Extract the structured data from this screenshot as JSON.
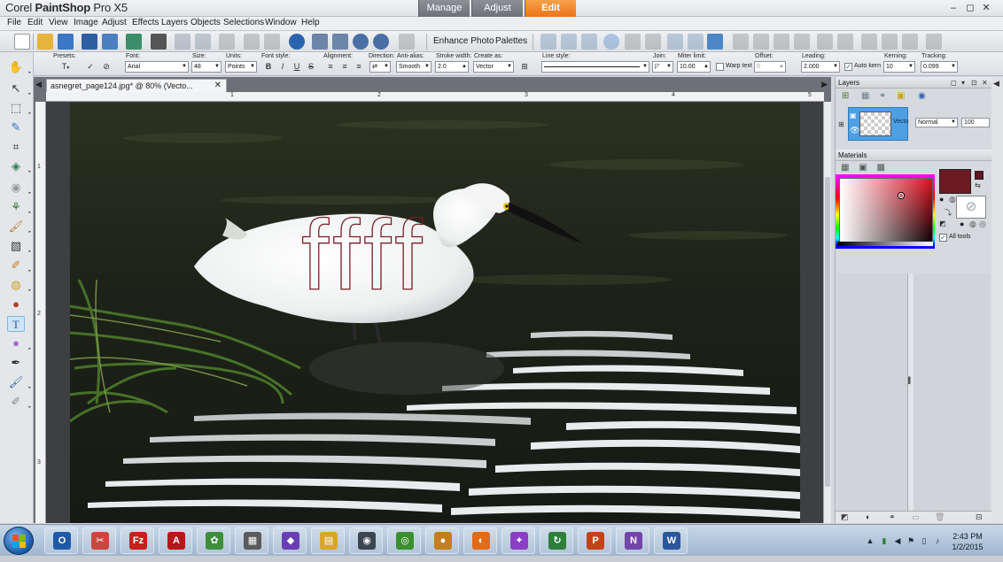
{
  "window": {
    "title_light": "Corel ",
    "title_bold": "PaintShop",
    "title_tail": " Pro X5",
    "workspace_tabs": [
      "Manage",
      "Adjust",
      "Edit"
    ],
    "active_tab": "Edit",
    "controls": {
      "minimize": "–",
      "restore": "◻",
      "close": "✕"
    }
  },
  "menu": [
    "File",
    "Edit",
    "View",
    "Image",
    "Adjust",
    "Effects",
    "Layers",
    "Objects",
    "Selections",
    "Window",
    "Help"
  ],
  "toolbar": {
    "enhance_photo": "Enhance Photo",
    "palettes": "Palettes"
  },
  "tool_options": {
    "presets_label": "Presets:",
    "font_label": "Font:",
    "font_value": "Arial",
    "size_label": "Size:",
    "size_value": "48",
    "units_label": "Units:",
    "units_value": "Points",
    "font_style_label": "Font style:",
    "style_buttons": [
      "B",
      "I",
      "U",
      "S"
    ],
    "alignment_label": "Alignment:",
    "direction_label": "Direction:",
    "antialias_label": "Anti-alias:",
    "antialias_value": "Smooth",
    "stroke_width_label": "Stroke width:",
    "stroke_width_value": "2.0",
    "create_as_label": "Create as:",
    "create_as_value": "Vector",
    "line_style_label": "Line style:",
    "join_label": "Join:",
    "miter_label": "Miter limit:",
    "miter_value": "10.00",
    "warp_text_label": "Warp text",
    "offset_label": "Offset:",
    "offset_value": "0",
    "leading_label": "Leading:",
    "leading_value": "2.000",
    "auto_kern_label": "Auto kern",
    "kerning_label": "Kerning:",
    "kerning_value": "10",
    "tracking_label": "Tracking:",
    "tracking_value": "0.099"
  },
  "document": {
    "tab_title": "asnegret_page124.jpg* @  80% (Vecto...",
    "overlay_text": "ffff",
    "ruler_h": [
      "1",
      "2",
      "3",
      "4",
      "5"
    ],
    "ruler_v": [
      "1",
      "2",
      "3"
    ]
  },
  "layers": {
    "title": "Layers",
    "layer_name": "Vecto",
    "blend_mode": "Normal",
    "opacity": "100"
  },
  "materials": {
    "title": "Materials",
    "all_tools_label": "All tools",
    "foreground_color": "#6b1a22",
    "background_color": "#5e1620"
  },
  "taskbar": {
    "apps": [
      {
        "name": "outlook",
        "glyph": "O",
        "color": "#1f5aa8"
      },
      {
        "name": "snipping-tool",
        "glyph": "✂",
        "color": "#c9473f"
      },
      {
        "name": "filezilla",
        "glyph": "Fz",
        "color": "#c8201b"
      },
      {
        "name": "acrobat",
        "glyph": "A",
        "color": "#b5181b"
      },
      {
        "name": "corel-paintshop",
        "glyph": "✿",
        "color": "#3f8f3a"
      },
      {
        "name": "photo-viewer",
        "glyph": "▦",
        "color": "#5a5a5a"
      },
      {
        "name": "paint-app",
        "glyph": "◆",
        "color": "#6a3fb5"
      },
      {
        "name": "explorer",
        "glyph": "▤",
        "color": "#d9a62b"
      },
      {
        "name": "camera",
        "glyph": "◉",
        "color": "#3b4650"
      },
      {
        "name": "chrome",
        "glyph": "◎",
        "color": "#3a8f2f"
      },
      {
        "name": "media-app",
        "glyph": "●",
        "color": "#c47f1c"
      },
      {
        "name": "firefox",
        "glyph": "◐",
        "color": "#e36b15"
      },
      {
        "name": "picasa",
        "glyph": "✦",
        "color": "#8a3fc4"
      },
      {
        "name": "sync-app",
        "glyph": "↻",
        "color": "#2f7f3a"
      },
      {
        "name": "powerpoint",
        "glyph": "P",
        "color": "#c24319"
      },
      {
        "name": "onenote",
        "glyph": "N",
        "color": "#7445a8"
      },
      {
        "name": "word",
        "glyph": "W",
        "color": "#2b579a"
      }
    ],
    "clock_time": "2:43 PM",
    "clock_date": "1/2/2015"
  }
}
